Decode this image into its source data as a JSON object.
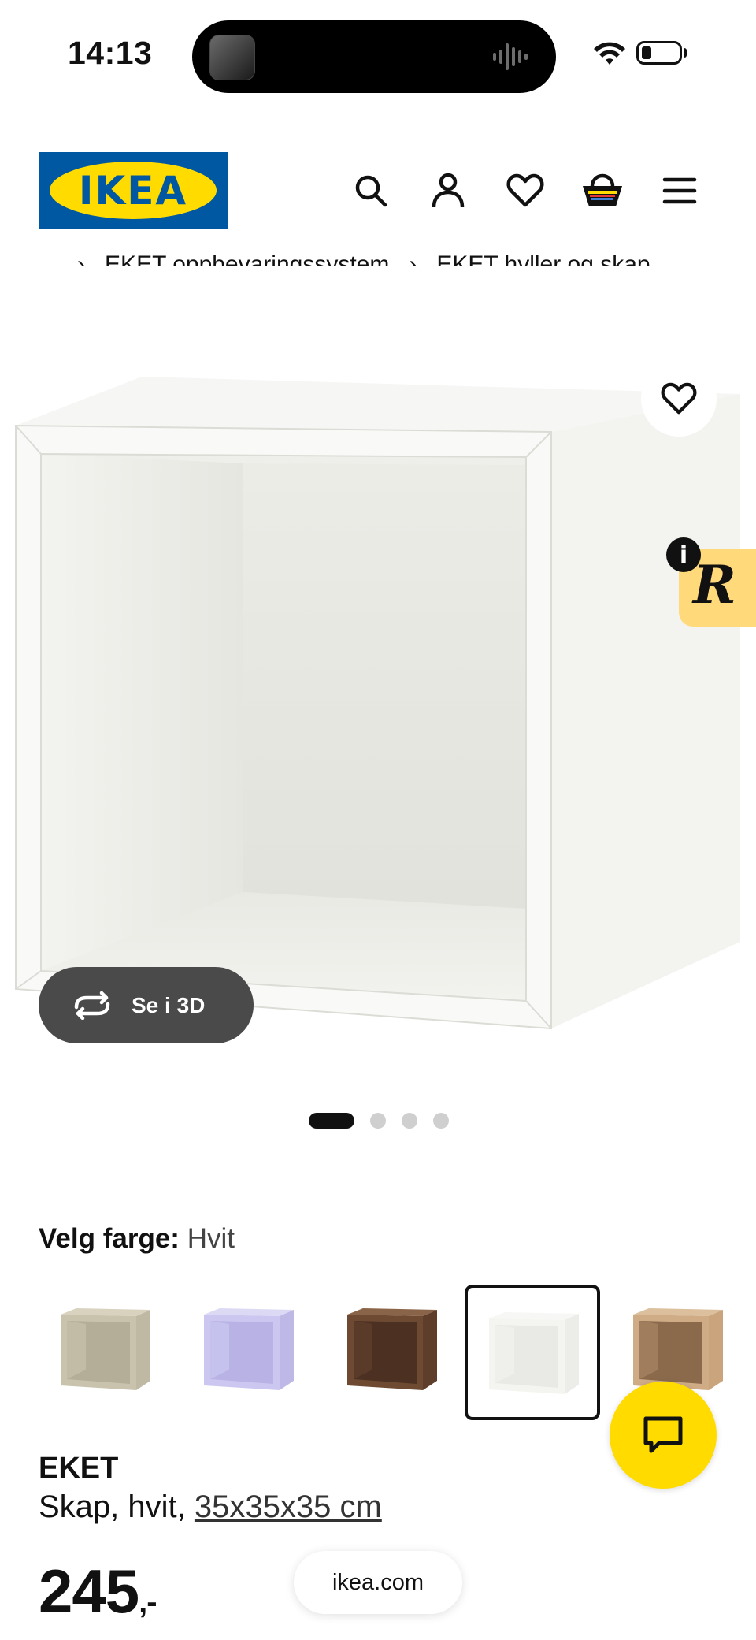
{
  "status_bar": {
    "time": "14:13"
  },
  "header": {
    "logo_text": "IKEA",
    "nav_icons": [
      "search-icon",
      "account-icon",
      "heart-icon",
      "cart-icon",
      "menu-icon"
    ]
  },
  "breadcrumb": {
    "items": [
      "...",
      "EKET oppbevaringssystem",
      "EKET hyller og skap"
    ],
    "separator": "›"
  },
  "gallery": {
    "view_3d_label": "Se i 3D",
    "page_count": 4,
    "active_page": 1
  },
  "color_picker": {
    "label": "Velg farge:",
    "selected_value": "Hvit",
    "swatches": [
      {
        "name": "beige",
        "color": "#c9c2ad",
        "selected": false
      },
      {
        "name": "lilac",
        "color": "#c8c4ec",
        "selected": false
      },
      {
        "name": "walnut",
        "color": "#6e4a33",
        "selected": false
      },
      {
        "name": "white",
        "color": "#f4f4f1",
        "selected": true
      },
      {
        "name": "oak",
        "color": "#cfac86",
        "selected": false
      }
    ]
  },
  "product": {
    "name": "EKET",
    "description": "Skap, hvit,",
    "size": "35x35x35 cm",
    "price": "245",
    "price_suffix": ",-"
  },
  "browser": {
    "url": "ikea.com"
  },
  "colors": {
    "brand_blue": "#0058a3",
    "brand_yellow": "#ffdb00",
    "badge_yellow": "#ffd97a"
  }
}
